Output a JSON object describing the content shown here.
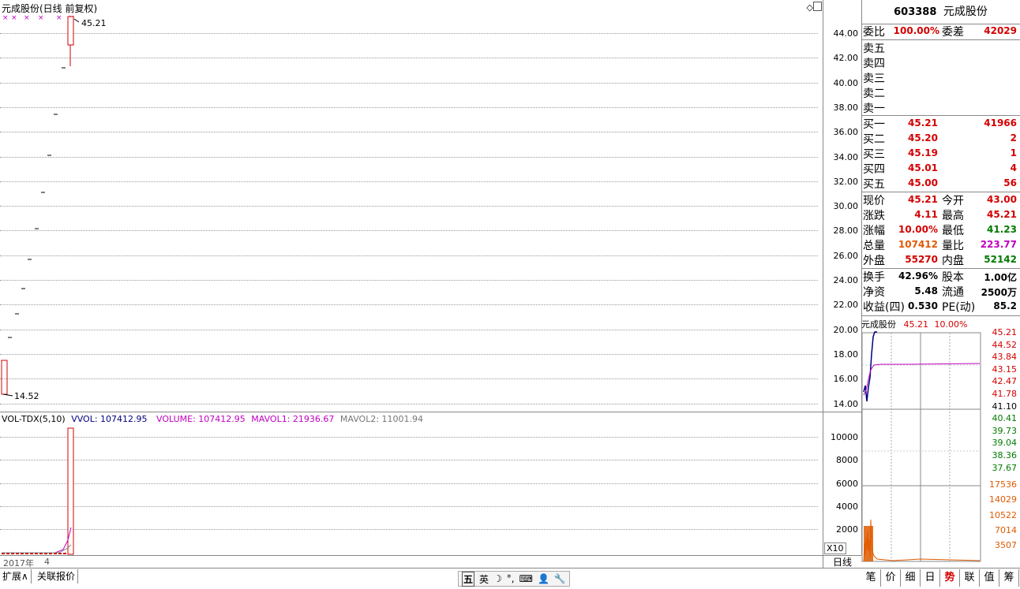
{
  "chart": {
    "title": "元成股份(日线 前复权)",
    "high_marker": "45.21",
    "low_marker": "14.52",
    "y_ticks": [
      "44.00",
      "42.00",
      "40.00",
      "38.00",
      "36.00",
      "34.00",
      "32.00",
      "30.00",
      "28.00",
      "26.00",
      "24.00",
      "22.00",
      "20.00",
      "18.00",
      "16.00",
      "14.00"
    ],
    "corner_icons": [
      "diamond-icon",
      "restore-icon"
    ]
  },
  "volume": {
    "indicator": "VOL-TDX(5,10)",
    "vvol_label": "VVOL: 107412.95",
    "volume_label": "VOLUME: 107412.95",
    "mavol1_label": "MAVOL1: 21936.67",
    "mavol2_label": "MAVOL2: 11001.94",
    "y_ticks": [
      "10000",
      "8000",
      "6000",
      "4000",
      "2000"
    ],
    "unit": "X10",
    "x_label_year": "2017年",
    "x_label_month": "4"
  },
  "colors": {
    "red": "#d40000",
    "green": "#007a00",
    "purple": "#c000c0",
    "orange": "#e05a00",
    "blue": "#000080"
  },
  "panel": {
    "stock_code": "603388",
    "stock_name": "元成股份",
    "weibi_label": "委比",
    "weibi_value": "100.00%",
    "weicha_label": "委差",
    "weicha_value": "42029",
    "sell": [
      {
        "label": "卖五",
        "price": "",
        "vol": ""
      },
      {
        "label": "卖四",
        "price": "",
        "vol": ""
      },
      {
        "label": "卖三",
        "price": "",
        "vol": ""
      },
      {
        "label": "卖二",
        "price": "",
        "vol": ""
      },
      {
        "label": "卖一",
        "price": "",
        "vol": ""
      }
    ],
    "buy": [
      {
        "label": "买一",
        "price": "45.21",
        "vol": "41966"
      },
      {
        "label": "买二",
        "price": "45.20",
        "vol": "2"
      },
      {
        "label": "买三",
        "price": "45.19",
        "vol": "1"
      },
      {
        "label": "买四",
        "price": "45.01",
        "vol": "4"
      },
      {
        "label": "买五",
        "price": "45.00",
        "vol": "56"
      }
    ],
    "quote": [
      {
        "k1": "现价",
        "v1": "45.21",
        "k2": "今开",
        "v2": "43.00"
      },
      {
        "k1": "涨跌",
        "v1": "4.11",
        "k2": "最高",
        "v2": "45.21"
      },
      {
        "k1": "涨幅",
        "v1": "10.00%",
        "k2": "最低",
        "v2": "41.23"
      },
      {
        "k1": "总量",
        "v1": "107412",
        "k2": "量比",
        "v2": "223.77"
      },
      {
        "k1": "外盘",
        "v1": "55270",
        "k2": "内盘",
        "v2": "52142"
      }
    ],
    "fund": [
      {
        "k1": "换手",
        "v1": "42.96%",
        "k2": "股本",
        "v2": "1.00亿"
      },
      {
        "k1": "净资",
        "v1": "5.48",
        "k2": "流通",
        "v2": "2500万"
      },
      {
        "k1": "收益(四)",
        "v1": "0.530",
        "k2": "PE(动)",
        "v2": "85.2"
      }
    ]
  },
  "mini": {
    "name": "元成股份",
    "price": "45.21",
    "pct": "10.00%",
    "price_ticks": [
      "45.21",
      "44.52",
      "43.84",
      "43.15",
      "42.47",
      "41.78",
      "41.10",
      "40.41",
      "39.73",
      "39.04",
      "38.36",
      "37.67"
    ],
    "vol_ticks": [
      "17536",
      "14029",
      "10522",
      "7014",
      "3507"
    ]
  },
  "bottom": {
    "expand_label": "扩展∧",
    "related_label": "关联报价",
    "period_label": "日线",
    "ime_items": [
      "五",
      "英",
      "☽",
      "°,",
      "⌨",
      "👤",
      "🔧"
    ],
    "tabs": [
      "笔",
      "价",
      "细",
      "日",
      "势",
      "联",
      "值",
      "筹"
    ]
  }
}
